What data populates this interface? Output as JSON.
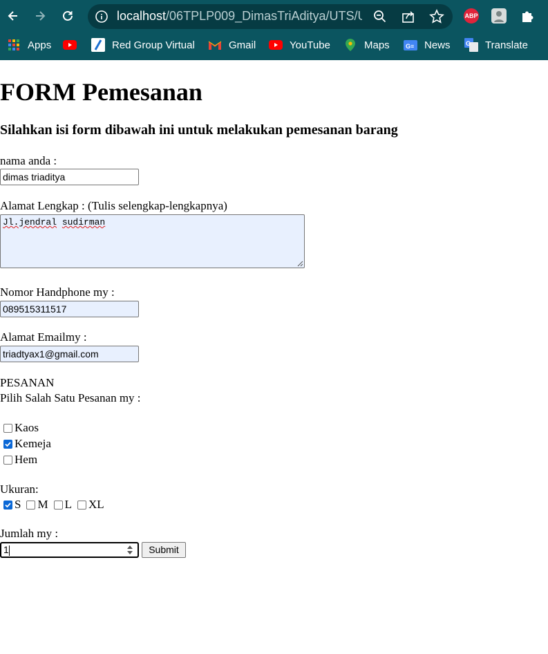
{
  "browser": {
    "url_host": "localhost",
    "url_path": "/06TPLP009_DimasTriAditya/UTS/U...",
    "ext_abp_label": "ABP",
    "colors": {
      "chrome": "#0b5560",
      "omnibox": "#063b43"
    }
  },
  "bookmarks": [
    {
      "label": "Apps",
      "icon": "apps-grid-icon"
    },
    {
      "label": "",
      "icon": "youtube-icon"
    },
    {
      "label": "Red Group Virtual",
      "icon": "red-group-icon"
    },
    {
      "label": "Gmail",
      "icon": "gmail-icon"
    },
    {
      "label": "YouTube",
      "icon": "youtube-icon"
    },
    {
      "label": "Maps",
      "icon": "maps-pin-icon"
    },
    {
      "label": "News",
      "icon": "google-news-icon"
    },
    {
      "label": "Translate",
      "icon": "google-translate-icon"
    }
  ],
  "form": {
    "title": "FORM Pemesanan",
    "subtitle": "Silahkan isi form dibawah ini untuk melakukan pemesanan barang",
    "name_label": "nama anda :",
    "name_value": "dimas triaditya",
    "address_label": "Alamat Lengkap : (Tulis selengkap-lengkapnya)",
    "address_word1": "Jl.jendral",
    "address_word2": "sudirman",
    "phone_label": "Nomor Handphone my :",
    "phone_value": "089515311517",
    "email_label": "Alamat Emailmy :",
    "email_value": "triadtyax1@gmail.com",
    "order_heading": "PESANAN",
    "order_instruction": "Pilih Salah Satu Pesanan my :",
    "items": [
      {
        "label": "Kaos",
        "checked": false
      },
      {
        "label": "Kemeja",
        "checked": true
      },
      {
        "label": "Hem",
        "checked": false
      }
    ],
    "size_label": "Ukuran:",
    "sizes": [
      {
        "label": "S",
        "checked": true
      },
      {
        "label": "M",
        "checked": false
      },
      {
        "label": "L",
        "checked": false
      },
      {
        "label": "XL",
        "checked": false
      }
    ],
    "quantity_label": "Jumlah my :",
    "quantity_value": "1",
    "submit_label": "Submit",
    "accent_color": "#0b68d6"
  }
}
